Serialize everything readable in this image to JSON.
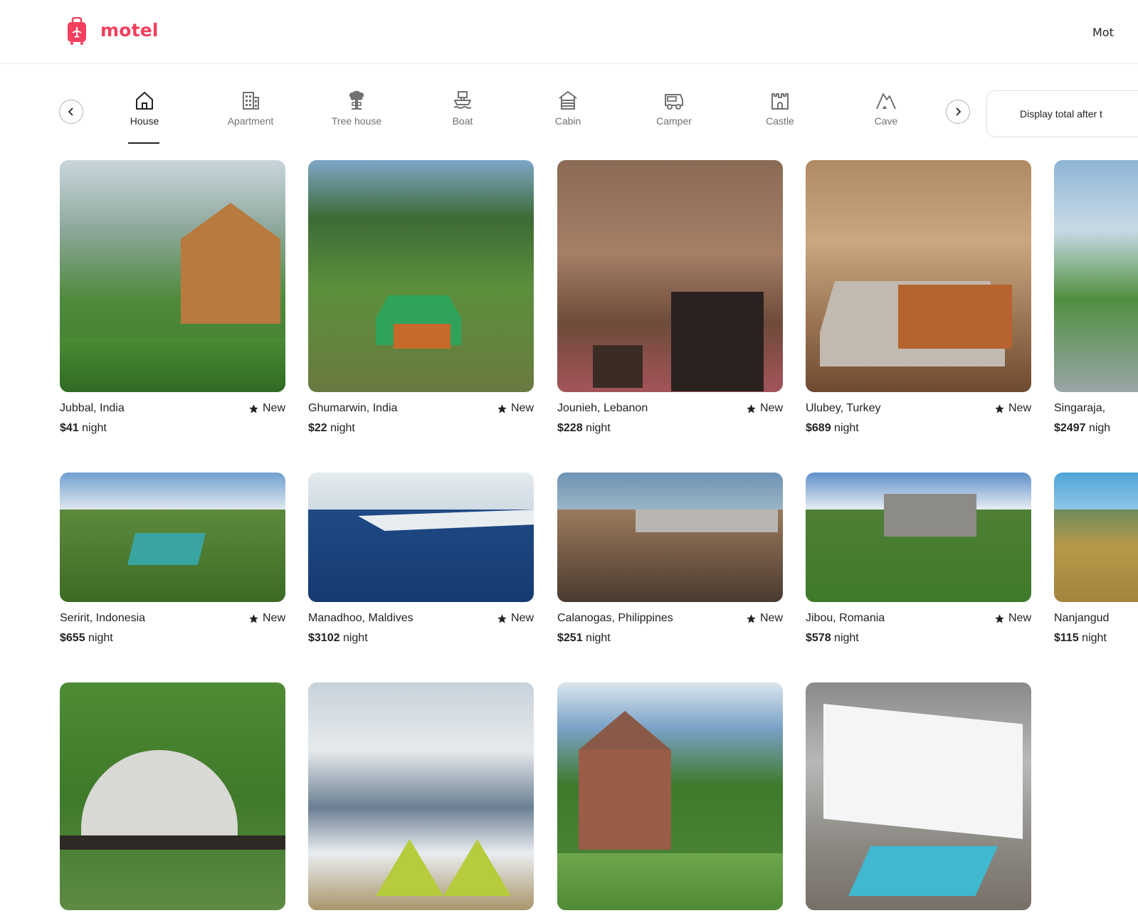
{
  "brand": {
    "name": "motel",
    "color": "#f43f5e"
  },
  "header": {
    "right_text": "Mot"
  },
  "categories": [
    {
      "label": "House",
      "icon": "house-icon",
      "active": true
    },
    {
      "label": "Apartment",
      "icon": "apartment-icon",
      "active": false
    },
    {
      "label": "Tree house",
      "icon": "tree-house-icon",
      "active": false
    },
    {
      "label": "Boat",
      "icon": "boat-icon",
      "active": false
    },
    {
      "label": "Cabin",
      "icon": "cabin-icon",
      "active": false
    },
    {
      "label": "Camper",
      "icon": "camper-icon",
      "active": false
    },
    {
      "label": "Castle",
      "icon": "castle-icon",
      "active": false
    },
    {
      "label": "Cave",
      "icon": "cave-icon",
      "active": false
    }
  ],
  "display_total": {
    "label": "Display total after t"
  },
  "listings": [
    {
      "location": "Jubbal, India",
      "rating": "New",
      "price": "$41",
      "unit": "night"
    },
    {
      "location": "Ghumarwin, India",
      "rating": "New",
      "price": "$22",
      "unit": "night"
    },
    {
      "location": "Jounieh, Lebanon",
      "rating": "New",
      "price": "$228",
      "unit": "night"
    },
    {
      "location": "Ulubey, Turkey",
      "rating": "New",
      "price": "$689",
      "unit": "night"
    },
    {
      "location": "Singaraja,",
      "rating": "",
      "price": "$2497",
      "unit": "nigh"
    },
    {
      "location": "Seririt, Indonesia",
      "rating": "New",
      "price": "$655",
      "unit": "night"
    },
    {
      "location": "Manadhoo, Maldives",
      "rating": "New",
      "price": "$3102",
      "unit": "night"
    },
    {
      "location": "Calanogas, Philippines",
      "rating": "New",
      "price": "$251",
      "unit": "night"
    },
    {
      "location": "Jibou, Romania",
      "rating": "New",
      "price": "$578",
      "unit": "night"
    },
    {
      "location": "Nanjangud",
      "rating": "",
      "price": "$115",
      "unit": "night"
    }
  ]
}
